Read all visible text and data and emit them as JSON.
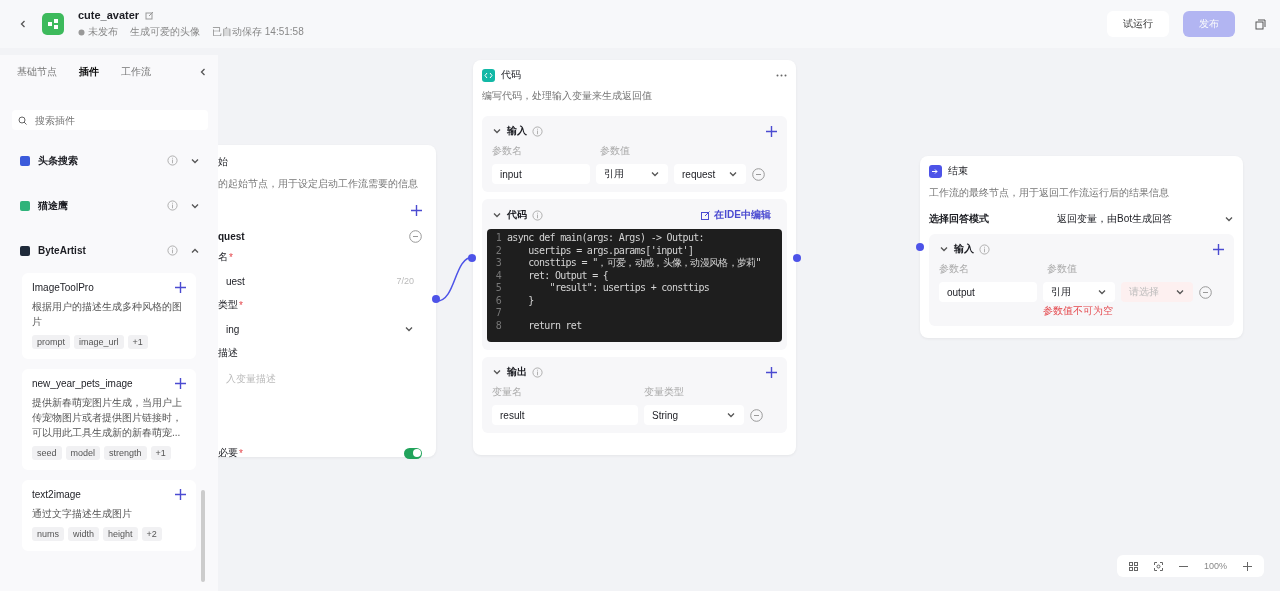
{
  "header": {
    "title": "cute_avater",
    "status": "未发布",
    "description": "生成可爱的头像",
    "saved": "已自动保存 14:51:58",
    "buttons": [
      {
        "label": "试运行",
        "kind": "secondary"
      },
      {
        "label": "发布",
        "kind": "primary",
        "disabled": true
      }
    ]
  },
  "sidebar": {
    "tabs": [
      {
        "label": "基础节点",
        "selected": false
      },
      {
        "label": "插件",
        "selected": true
      },
      {
        "label": "工作流",
        "selected": false
      }
    ],
    "search": {
      "placeholder": "搜索插件"
    },
    "plugins": [
      {
        "name": "头条搜索",
        "expanded": false,
        "color": "#3b5bdb"
      },
      {
        "name": "猫途鹰",
        "expanded": false,
        "color": "#2fb37a"
      },
      {
        "name": "ByteArtist",
        "expanded": true,
        "color": "#1f2a3a",
        "tools": [
          {
            "name": "ImageToolPro",
            "description": "根据用户的描述生成多种风格的图片",
            "tags": [
              "prompt",
              "image_url",
              "+1"
            ]
          },
          {
            "name": "new_year_pets_image",
            "description": "提供新春萌宠图片生成，当用户上传宠物图片或者提供图片链接时，可以用此工具生成新的新春萌宠...",
            "tags": [
              "seed",
              "model",
              "strength",
              "+1"
            ]
          },
          {
            "name": "text2image",
            "description": "通过文字描述生成图片",
            "tags": [
              "nums",
              "width",
              "height",
              "+2"
            ]
          }
        ]
      }
    ]
  },
  "start_node": {
    "title": "始",
    "description": "的起始节点，用于设定启动工作流需要的信息",
    "param": "quest",
    "fields": [
      {
        "label": "名",
        "mark": "*",
        "kind": "text",
        "value": "uest",
        "counter": "7/20"
      },
      {
        "label": "类型",
        "mark": "*",
        "kind": "select",
        "value": "ing"
      },
      {
        "label": "描述",
        "kind": "textarea",
        "placeholder": "入变量描述"
      },
      {
        "label": "必要",
        "mark": "*",
        "kind": "toggle",
        "on": true
      }
    ]
  },
  "code_node": {
    "title": "代码",
    "description": "编写代码，处理输入变量来生成返回值",
    "input": {
      "title": "输入",
      "columns": [
        "参数名",
        "参数值"
      ],
      "rows": [
        {
          "name": "input",
          "mode": "引用",
          "value": "request"
        }
      ]
    },
    "code": {
      "title": "代码",
      "link": "在IDE中编辑",
      "lines": [
        {
          "number": "1",
          "text": "async def main(args: Args) -> Output:"
        },
        {
          "number": "2",
          "text": "    usertips = args.params['input']"
        },
        {
          "number": "3",
          "text": "    consttips = \"，可爱，动感，头像，动漫风格，萝莉\""
        },
        {
          "number": "4",
          "text": "    ret: Output = {"
        },
        {
          "number": "5",
          "text": "        \"result\": usertips + consttips"
        },
        {
          "number": "6",
          "text": "    }"
        },
        {
          "number": "7"
        },
        {
          "number": "8",
          "text": "    return ret"
        }
      ]
    },
    "output": {
      "title": "输出",
      "columns": [
        "变量名",
        "变量类型"
      ],
      "rows": [
        {
          "name": "result",
          "type": "String"
        }
      ]
    }
  },
  "end_node": {
    "title": "结束",
    "description": "工作流的最终节点，用于返回工作流运行后的结果信息",
    "mode_label": "选择回答模式",
    "mode_value": "返回变量，由Bot生成回答",
    "input": {
      "title": "输入",
      "columns": [
        "参数名",
        "参数值"
      ],
      "rows": [
        {
          "name": "output",
          "mode": "引用",
          "placeholder": "请选择",
          "error": "参数值不可为空"
        }
      ]
    }
  },
  "zoom": {
    "level": "100%"
  }
}
